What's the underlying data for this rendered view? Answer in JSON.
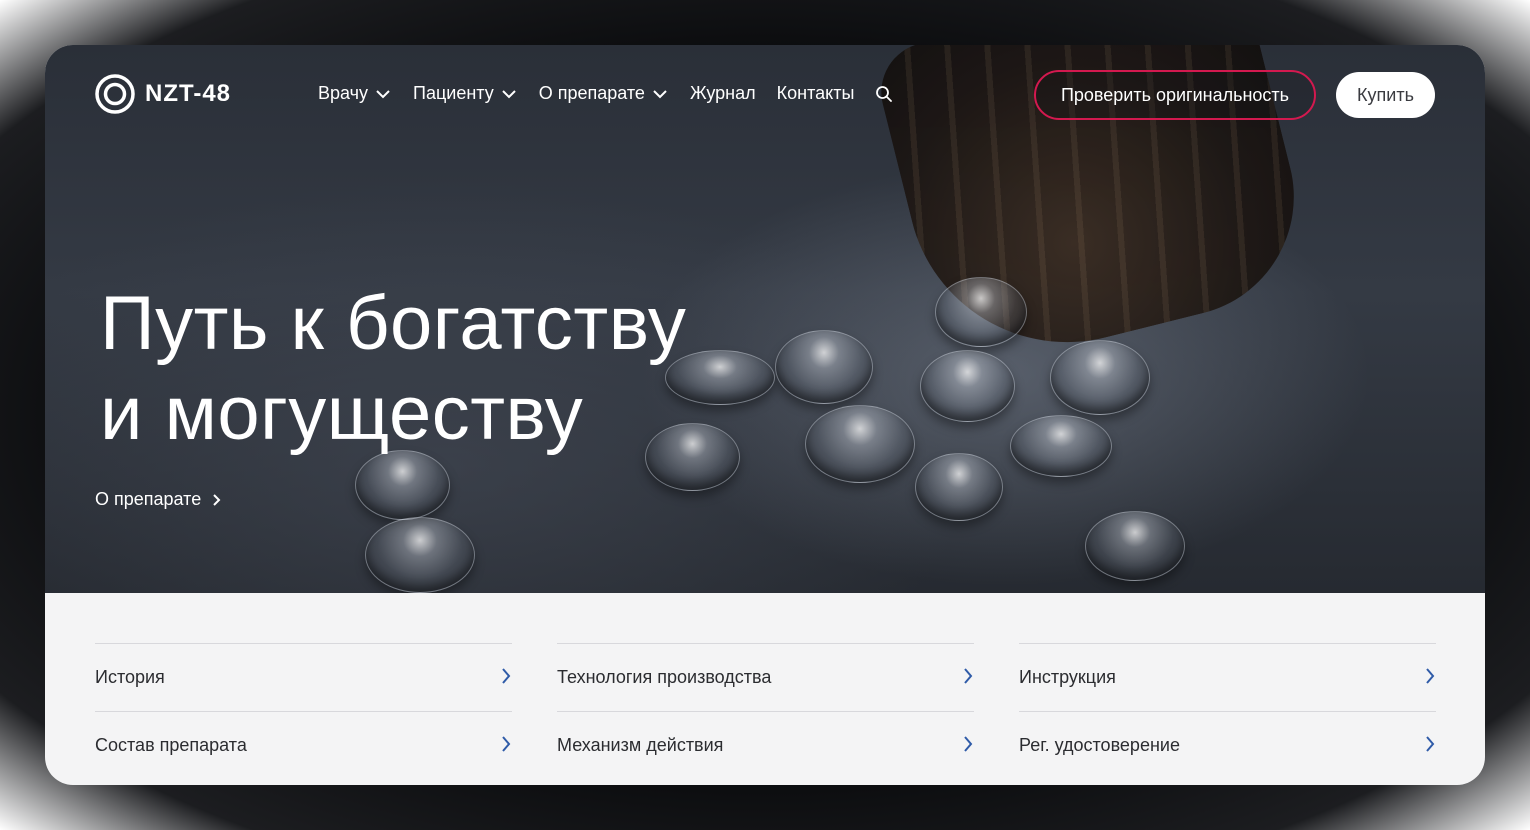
{
  "brand": {
    "name": "NZT-48",
    "icon": "concentric-circles-logo"
  },
  "nav": {
    "items": [
      {
        "label": "Врачу",
        "has_dropdown": true
      },
      {
        "label": "Пациенту",
        "has_dropdown": true
      },
      {
        "label": "О препарате",
        "has_dropdown": true
      },
      {
        "label": "Журнал",
        "has_dropdown": false
      },
      {
        "label": "Контакты",
        "has_dropdown": false
      }
    ],
    "search_icon": "search-icon",
    "check_button": "Проверить оригинальность",
    "buy_button": "Купить"
  },
  "hero": {
    "title_line1": "Путь к богатству",
    "title_line2": "и могуществу",
    "link": "О препарате"
  },
  "quick_links": [
    {
      "label": "История"
    },
    {
      "label": "Технология производства"
    },
    {
      "label": "Инструкция"
    },
    {
      "label": "Состав препарата"
    },
    {
      "label": "Механизм действия"
    },
    {
      "label": "Рег. удостоверение"
    }
  ],
  "colors": {
    "accent": "#d3194f",
    "link_arrow": "#2f5ba8",
    "hero_bg": "#2f343d",
    "panel_bg": "#f4f4f5"
  }
}
